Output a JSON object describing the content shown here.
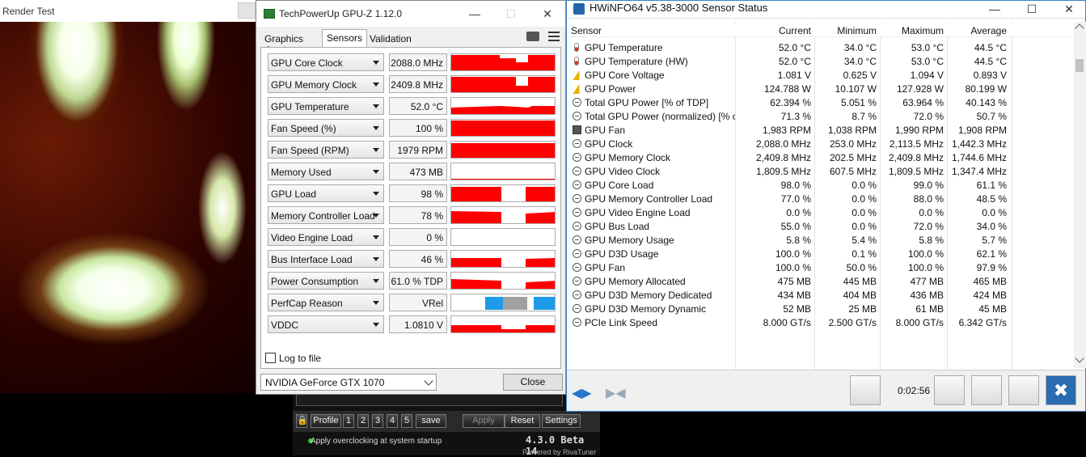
{
  "render_test": {
    "title": "Render Test"
  },
  "gpuz": {
    "title": "TechPowerUp GPU-Z 1.12.0",
    "tabs": [
      "Graphics Card",
      "Sensors",
      "Validation"
    ],
    "active_tab": "Sensors",
    "sensors": [
      {
        "label": "GPU Core Clock",
        "value": "2088.0 MHz"
      },
      {
        "label": "GPU Memory Clock",
        "value": "2409.8 MHz"
      },
      {
        "label": "GPU Temperature",
        "value": "52.0 °C"
      },
      {
        "label": "Fan Speed (%)",
        "value": "100 %"
      },
      {
        "label": "Fan Speed (RPM)",
        "value": "1979 RPM"
      },
      {
        "label": "Memory Used",
        "value": "473 MB"
      },
      {
        "label": "GPU Load",
        "value": "98 %"
      },
      {
        "label": "Memory Controller Load",
        "value": "78 %"
      },
      {
        "label": "Video Engine Load",
        "value": "0 %"
      },
      {
        "label": "Bus Interface Load",
        "value": "46 %"
      },
      {
        "label": "Power Consumption",
        "value": "61.0 % TDP"
      },
      {
        "label": "PerfCap Reason",
        "value": "VRel"
      },
      {
        "label": "VDDC",
        "value": "1.0810 V"
      }
    ],
    "log_label": "Log to file",
    "device": "NVIDIA GeForce GTX 1070",
    "close_label": "Close",
    "graph_color": "#ff0000",
    "perfcap_colors": [
      "#1e9be8",
      "#a0a0a0",
      "#1e9be8"
    ]
  },
  "rtss": {
    "profile_label": "Profile",
    "profiles": [
      "1",
      "2",
      "3",
      "4",
      "5"
    ],
    "save_label": "save",
    "apply_label": "Apply",
    "reset_label": "Reset",
    "settings_label": "Settings",
    "status_text": "Apply overclocking at system startup",
    "version": "4.3.0 Beta 14",
    "powered_by": "Powered by RivaTuner"
  },
  "hwinfo": {
    "title": "HWiNFO64 v5.38-3000 Sensor Status",
    "headers": {
      "sensor": "Sensor",
      "current": "Current",
      "minimum": "Minimum",
      "maximum": "Maximum",
      "average": "Average"
    },
    "rows": [
      {
        "icon": "thermometer-icon",
        "name": "GPU Temperature",
        "current": "52.0 °C",
        "min": "34.0 °C",
        "max": "53.0 °C",
        "avg": "44.5 °C"
      },
      {
        "icon": "thermometer-icon",
        "name": "GPU Temperature (HW)",
        "current": "52.0 °C",
        "min": "34.0 °C",
        "max": "53.0 °C",
        "avg": "44.5 °C"
      },
      {
        "icon": "lightning-icon",
        "name": "GPU Core Voltage",
        "current": "1.081 V",
        "min": "0.625 V",
        "max": "1.094 V",
        "avg": "0.893 V"
      },
      {
        "icon": "lightning-icon",
        "name": "GPU Power",
        "current": "124.788 W",
        "min": "10.107 W",
        "max": "127.928 W",
        "avg": "80.199 W"
      },
      {
        "icon": "gauge-icon",
        "name": "Total GPU Power [% of TDP]",
        "current": "62.394 %",
        "min": "5.051 %",
        "max": "63.964 %",
        "avg": "40.143 %"
      },
      {
        "icon": "gauge-icon",
        "name": "Total GPU Power (normalized) [% of...",
        "current": "71.3 %",
        "min": "8.7 %",
        "max": "72.0 %",
        "avg": "50.7 %"
      },
      {
        "icon": "fan-icon",
        "name": "GPU Fan",
        "current": "1,983 RPM",
        "min": "1,038 RPM",
        "max": "1,990 RPM",
        "avg": "1,908 RPM"
      },
      {
        "icon": "gauge-icon",
        "name": "GPU Clock",
        "current": "2,088.0 MHz",
        "min": "253.0 MHz",
        "max": "2,113.5 MHz",
        "avg": "1,442.3 MHz"
      },
      {
        "icon": "gauge-icon",
        "name": "GPU Memory Clock",
        "current": "2,409.8 MHz",
        "min": "202.5 MHz",
        "max": "2,409.8 MHz",
        "avg": "1,744.6 MHz"
      },
      {
        "icon": "gauge-icon",
        "name": "GPU Video Clock",
        "current": "1,809.5 MHz",
        "min": "607.5 MHz",
        "max": "1,809.5 MHz",
        "avg": "1,347.4 MHz"
      },
      {
        "icon": "gauge-icon",
        "name": "GPU Core Load",
        "current": "98.0 %",
        "min": "0.0 %",
        "max": "99.0 %",
        "avg": "61.1 %"
      },
      {
        "icon": "gauge-icon",
        "name": "GPU Memory Controller Load",
        "current": "77.0 %",
        "min": "0.0 %",
        "max": "88.0 %",
        "avg": "48.5 %"
      },
      {
        "icon": "gauge-icon",
        "name": "GPU Video Engine Load",
        "current": "0.0 %",
        "min": "0.0 %",
        "max": "0.0 %",
        "avg": "0.0 %"
      },
      {
        "icon": "gauge-icon",
        "name": "GPU Bus Load",
        "current": "55.0 %",
        "min": "0.0 %",
        "max": "72.0 %",
        "avg": "34.0 %"
      },
      {
        "icon": "gauge-icon",
        "name": "GPU Memory Usage",
        "current": "5.8 %",
        "min": "5.4 %",
        "max": "5.8 %",
        "avg": "5.7 %"
      },
      {
        "icon": "gauge-icon",
        "name": "GPU D3D Usage",
        "current": "100.0 %",
        "min": "0.1 %",
        "max": "100.0 %",
        "avg": "62.1 %"
      },
      {
        "icon": "gauge-icon",
        "name": "GPU Fan",
        "current": "100.0 %",
        "min": "50.0 %",
        "max": "100.0 %",
        "avg": "97.9 %"
      },
      {
        "icon": "gauge-icon",
        "name": "GPU Memory Allocated",
        "current": "475 MB",
        "min": "445 MB",
        "max": "477 MB",
        "avg": "465 MB"
      },
      {
        "icon": "gauge-icon",
        "name": "GPU D3D Memory Dedicated",
        "current": "434 MB",
        "min": "404 MB",
        "max": "436 MB",
        "avg": "424 MB"
      },
      {
        "icon": "gauge-icon",
        "name": "GPU D3D Memory Dynamic",
        "current": "52 MB",
        "min": "25 MB",
        "max": "61 MB",
        "avg": "45 MB"
      },
      {
        "icon": "gauge-icon",
        "name": "PCIe Link Speed",
        "current": "8.000 GT/s",
        "min": "2.500 GT/s",
        "max": "8.000 GT/s",
        "avg": "6.342 GT/s"
      }
    ],
    "timer": "0:02:56"
  }
}
